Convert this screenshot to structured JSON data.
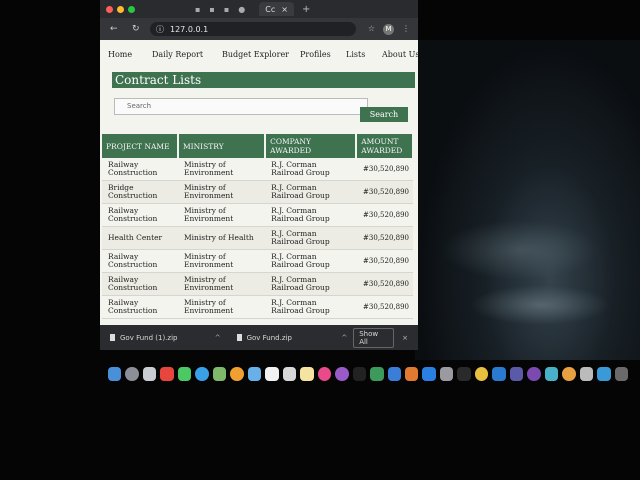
{
  "browser": {
    "tab_title": "Cc",
    "tab_close": "×",
    "new_tab": "+",
    "url": "127.0.0.1",
    "profile_initial": "M"
  },
  "nav": {
    "items": [
      "Home",
      "Daily Report",
      "Budget Explorer",
      "Profiles",
      "Lists",
      "About Us"
    ]
  },
  "page": {
    "title": "Contract Lists",
    "search_placeholder": "Search",
    "search_button": "Search"
  },
  "table": {
    "headers": [
      "PROJECT NAME",
      "MINISTRY",
      "COMPANY AWARDED",
      "AMOUNT AWARDED"
    ],
    "rows": [
      [
        "Railway Construction",
        "Ministry of Environment",
        "R.J. Corman Railroad Group",
        "#30,520,890"
      ],
      [
        "Bridge Construction",
        "Ministry of Environment",
        "R.J. Corman Railroad Group",
        "#30,520,890"
      ],
      [
        "Railway Construction",
        "Ministry of Environment",
        "R.J. Corman Railroad Group",
        "#30,520,890"
      ],
      [
        "Health Center",
        "Ministry of Health",
        "R.J. Corman Railroad Group",
        "#30,520,890"
      ],
      [
        "Railway Construction",
        "Ministry of Environment",
        "R.J. Corman Railroad Group",
        "#30,520,890"
      ],
      [
        "Railway Construction",
        "Ministry of Environment",
        "R.J. Corman Railroad Group",
        "#30,520,890"
      ],
      [
        "Railway Construction",
        "Ministry of Environment",
        "R.J. Corman Railroad Group",
        "#30,520,890"
      ]
    ]
  },
  "downloads": {
    "items": [
      "Gov Fund (1).zip",
      "Gov Fund.zip"
    ],
    "show_all": "Show All",
    "close": "×"
  },
  "colors": {
    "accent_green": "#3f7350",
    "page_bg": "#f4f4ee"
  }
}
